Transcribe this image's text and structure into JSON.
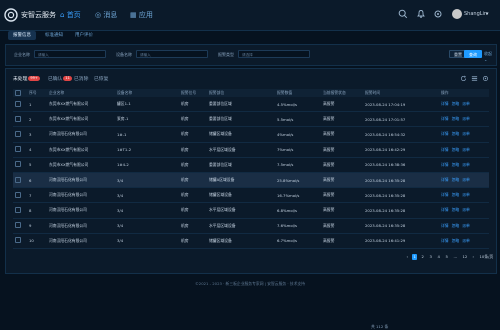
{
  "app": {
    "title": "安智云服务"
  },
  "nav": [
    {
      "label": "首页",
      "icon": "home-icon",
      "active": true
    },
    {
      "label": "消息",
      "icon": "message-icon",
      "active": false
    },
    {
      "label": "应用",
      "icon": "apps-icon",
      "active": false
    }
  ],
  "user": {
    "name": "ShangLin"
  },
  "subtabs": [
    {
      "label": "报警信息",
      "active": true
    },
    {
      "label": "标准通知",
      "active": false
    },
    {
      "label": "用户评价",
      "active": false
    }
  ],
  "filters": {
    "company_label": "企业名称",
    "company_placeholder": "请输入",
    "device_label": "设备名称",
    "device_placeholder": "请输入",
    "alarm_label": "报警类型",
    "alarm_placeholder": "请选择",
    "reset_label": "重置",
    "query_label": "查询",
    "collapse_label": "收起"
  },
  "status_tabs": [
    {
      "label": "未处理",
      "badge": "99+",
      "active": true
    },
    {
      "label": "已确认",
      "badge": "11",
      "active": false
    },
    {
      "label": "已消除",
      "badge": "",
      "active": false
    },
    {
      "label": "已恢复",
      "badge": "",
      "active": false
    }
  ],
  "table": {
    "headers": [
      "",
      "序号",
      "企业名称",
      "设备名称",
      "报警位号",
      "报警部位",
      "报警数值",
      "当前报警状态",
      "报警时间",
      "操作"
    ],
    "rows": [
      {
        "no": "1",
        "company": "东莞市XX燃气有限公司",
        "device": "罐区1-1",
        "tag": "机房",
        "location": "重要部位区域",
        "value": "4.5%mol/s",
        "status": "高报警",
        "time": "2023-08-24 17:04:19",
        "actions": [
          "详情",
          "忽略",
          "派单"
        ],
        "highlight": false
      },
      {
        "no": "2",
        "company": "东莞市XX燃气有限公司",
        "device": "泵房-1",
        "tag": "机房",
        "location": "重要部位区域",
        "value": "5.5mol/s",
        "status": "高报警",
        "time": "2023-08-24 17:01:57",
        "actions": [
          "详情",
          "忽略",
          "派单"
        ],
        "highlight": false
      },
      {
        "no": "3",
        "company": "河南汉阳石化有限公司",
        "device": "1#-1",
        "tag": "机房",
        "location": "储罐区域设备",
        "value": "4%mol/s",
        "status": "高报警",
        "time": "2023-08-24 16:54:32",
        "actions": [
          "详情",
          "忽略",
          "派单"
        ],
        "highlight": false
      },
      {
        "no": "4",
        "company": "东莞市XX燃气有限公司",
        "device": "1#T1-2",
        "tag": "机房",
        "location": "水平层区域设备",
        "value": "7%mol/s",
        "status": "高报警",
        "time": "2023-08-24 16:42:29",
        "actions": [
          "详情",
          "忽略",
          "派单"
        ],
        "highlight": false
      },
      {
        "no": "5",
        "company": "东莞市XX燃气有限公司",
        "device": "1#4-2",
        "tag": "机房",
        "location": "重要部位区域",
        "value": "7.5mol/s",
        "status": "高报警",
        "time": "2023-08-24 16:38:36",
        "actions": [
          "详情",
          "忽略",
          "派单"
        ],
        "highlight": false
      },
      {
        "no": "6",
        "company": "河南汉阳石化有限公司",
        "device": "3/4",
        "tag": "机房",
        "location": "储罐A区域设备",
        "value": "25.8%mol/s",
        "status": "高报警",
        "time": "2023-08-24 16:35:28",
        "actions": [
          "详情",
          "忽略",
          "派单"
        ],
        "highlight": true
      },
      {
        "no": "7",
        "company": "河南汉阳石化有限公司",
        "device": "3/4",
        "tag": "机房",
        "location": "储罐区域设备",
        "value": "16.7%mol/s",
        "status": "高报警",
        "time": "2023-08-24 16:35:28",
        "actions": [
          "详情",
          "忽略",
          "派单"
        ],
        "highlight": false
      },
      {
        "no": "8",
        "company": "河南汉阳石化有限公司",
        "device": "3/4",
        "tag": "机房",
        "location": "水平层区域设备",
        "value": "6.8%mol/s",
        "status": "高报警",
        "time": "2023-08-24 16:35:28",
        "actions": [
          "详情",
          "忽略",
          "派单"
        ],
        "highlight": false
      },
      {
        "no": "9",
        "company": "河南汉阳石化有限公司",
        "device": "3/4",
        "tag": "机房",
        "location": "水平层区域设备",
        "value": "7.6%mol/s",
        "status": "高报警",
        "time": "2023-08-24 16:35:28",
        "actions": [
          "详情",
          "忽略",
          "派单"
        ],
        "highlight": false
      },
      {
        "no": "10",
        "company": "河南汉阳石化有限公司",
        "device": "3/4",
        "tag": "机房",
        "location": "储罐区域设备",
        "value": "6.7%mol/s",
        "status": "高报警",
        "time": "2023-08-24 16:41:29",
        "actions": [
          "详情",
          "忽略",
          "派单"
        ],
        "highlight": false
      }
    ]
  },
  "pagination": {
    "total_text": "共 112 条",
    "page_size": "10条/页",
    "pages": [
      "1",
      "2",
      "3",
      "4",
      "5",
      "...",
      "12"
    ],
    "active_page": "1",
    "prev": "‹",
    "next": "›"
  },
  "footer": {
    "text": "©2021 - 2023 · 新三板企业服务专家网 | 安智云服务 · 技术支持"
  },
  "colors": {
    "accent": "#1f9bff",
    "warn": "#ff4d4f",
    "bg": "#06121f"
  }
}
